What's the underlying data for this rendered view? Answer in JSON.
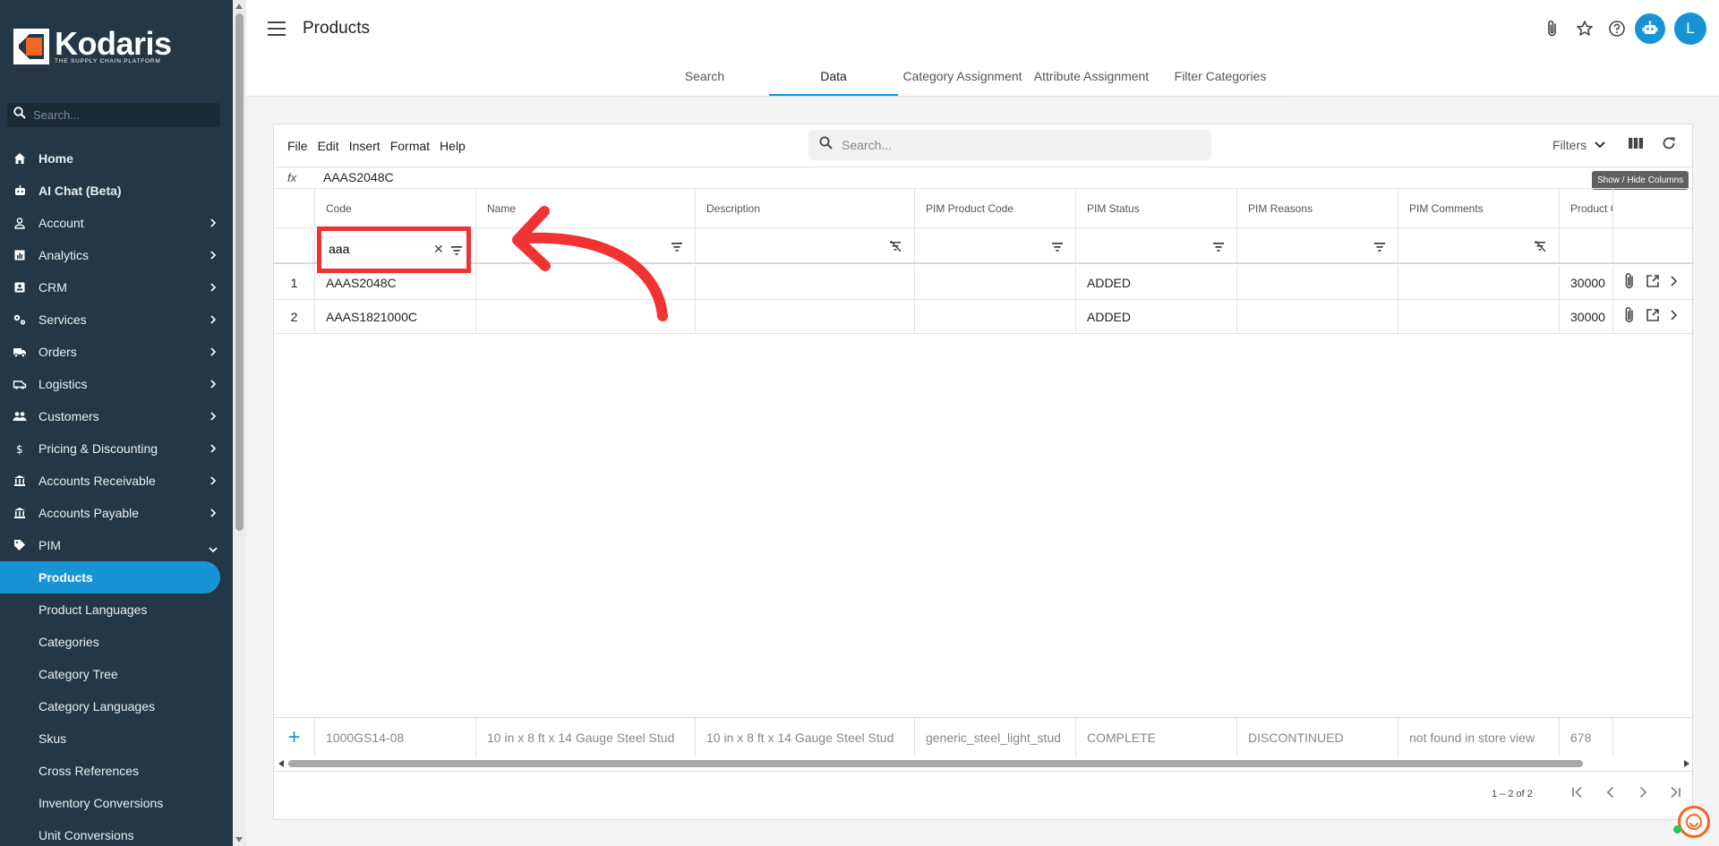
{
  "brand": {
    "name": "Kodaris",
    "tagline": "THE SUPPLY CHAIN PLATFORM"
  },
  "sidebar": {
    "search_placeholder": "Search...",
    "items": [
      {
        "label": "Home",
        "icon": "home-icon",
        "chevron": false,
        "bold": true
      },
      {
        "label": "AI Chat (Beta)",
        "icon": "robot-icon",
        "chevron": false,
        "bold": true
      },
      {
        "label": "Account",
        "icon": "person-icon",
        "chevron": true
      },
      {
        "label": "Analytics",
        "icon": "chart-icon",
        "chevron": true
      },
      {
        "label": "CRM",
        "icon": "contact-icon",
        "chevron": true
      },
      {
        "label": "Services",
        "icon": "gears-icon",
        "chevron": true
      },
      {
        "label": "Orders",
        "icon": "truck-icon",
        "chevron": true
      },
      {
        "label": "Logistics",
        "icon": "van-icon",
        "chevron": true
      },
      {
        "label": "Customers",
        "icon": "people-icon",
        "chevron": true
      },
      {
        "label": "Pricing & Discounting",
        "icon": "dollar-icon",
        "chevron": true
      },
      {
        "label": "Accounts Receivable",
        "icon": "bank-icon",
        "chevron": true
      },
      {
        "label": "Accounts Payable",
        "icon": "bank-icon",
        "chevron": true
      },
      {
        "label": "PIM",
        "icon": "tag-icon",
        "chevron": true,
        "expanded": true
      }
    ],
    "sub_items": [
      {
        "label": "Products",
        "active": true
      },
      {
        "label": "Product Languages"
      },
      {
        "label": "Categories"
      },
      {
        "label": "Category Tree"
      },
      {
        "label": "Category Languages"
      },
      {
        "label": "Skus"
      },
      {
        "label": "Cross References"
      },
      {
        "label": "Inventory Conversions"
      },
      {
        "label": "Unit Conversions"
      }
    ]
  },
  "header": {
    "title": "Products",
    "user_initial": "L",
    "tabs": [
      {
        "label": "Search"
      },
      {
        "label": "Data",
        "active": true
      },
      {
        "label": "Category Assignment"
      },
      {
        "label": "Attribute Assignment"
      },
      {
        "label": "Filter Categories"
      }
    ]
  },
  "toolbar": {
    "menus": [
      "File",
      "Edit",
      "Insert",
      "Format",
      "Help"
    ],
    "search_placeholder": "Search...",
    "filters_label": "Filters",
    "tooltip": "Show / Hide Columns"
  },
  "formula": {
    "label": "fx",
    "value": "AAAS2048C"
  },
  "grid": {
    "columns": [
      "Code",
      "Name",
      "Description",
      "PIM Product Code",
      "PIM Status",
      "PIM Reasons",
      "PIM Comments",
      "Product C"
    ],
    "code_filter_value": "aaa",
    "rows": [
      {
        "num": "1",
        "cells": [
          "AAAS2048C",
          "",
          "",
          "",
          "ADDED",
          "",
          "",
          "30000"
        ]
      },
      {
        "num": "2",
        "cells": [
          "AAAS1821000C",
          "",
          "",
          "",
          "ADDED",
          "",
          "",
          "30000"
        ]
      }
    ],
    "new_row": [
      "1000GS14-08",
      "10 in x 8 ft x 14 Gauge Steel Stud",
      "10 in x 8 ft x 14 Gauge Steel Stud",
      "generic_steel_light_stud",
      "COMPLETE",
      "DISCONTINUED",
      "not found in store view",
      "678"
    ],
    "pager_range": "1 – 2 of 2"
  },
  "colors": {
    "sidebar_bg": "#253746",
    "accent": "#1894d6",
    "annotation": "#f03232",
    "logo_orange": "#f26522"
  }
}
